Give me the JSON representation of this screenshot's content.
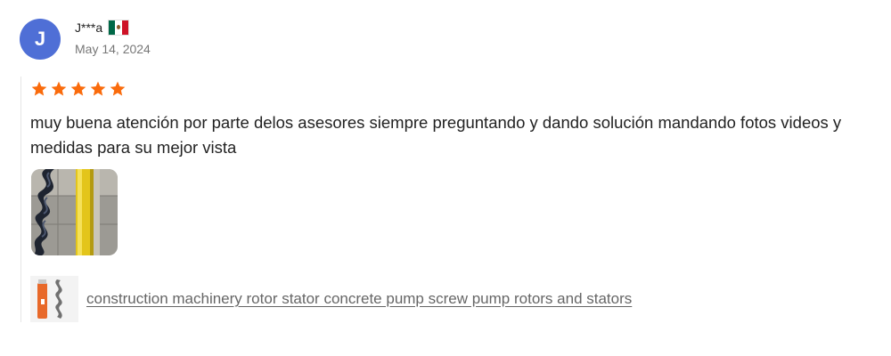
{
  "reviewer": {
    "initial": "J",
    "name": "J***a",
    "country_flag": "mexico-flag-icon",
    "avatar_color": "#4f6fd6"
  },
  "review": {
    "date": "May 14, 2024",
    "rating": 5,
    "rating_max": 5,
    "star_color": "#fa6b0c",
    "text": "muy buena atención por parte delos asesores siempre preguntando y dando solución mandando fotos videos y medidas para su mejor vista",
    "photos": [
      "review-photo-rotor-stator"
    ]
  },
  "product": {
    "title": "construction machinery rotor stator concrete pump screw pump rotors and stators"
  }
}
